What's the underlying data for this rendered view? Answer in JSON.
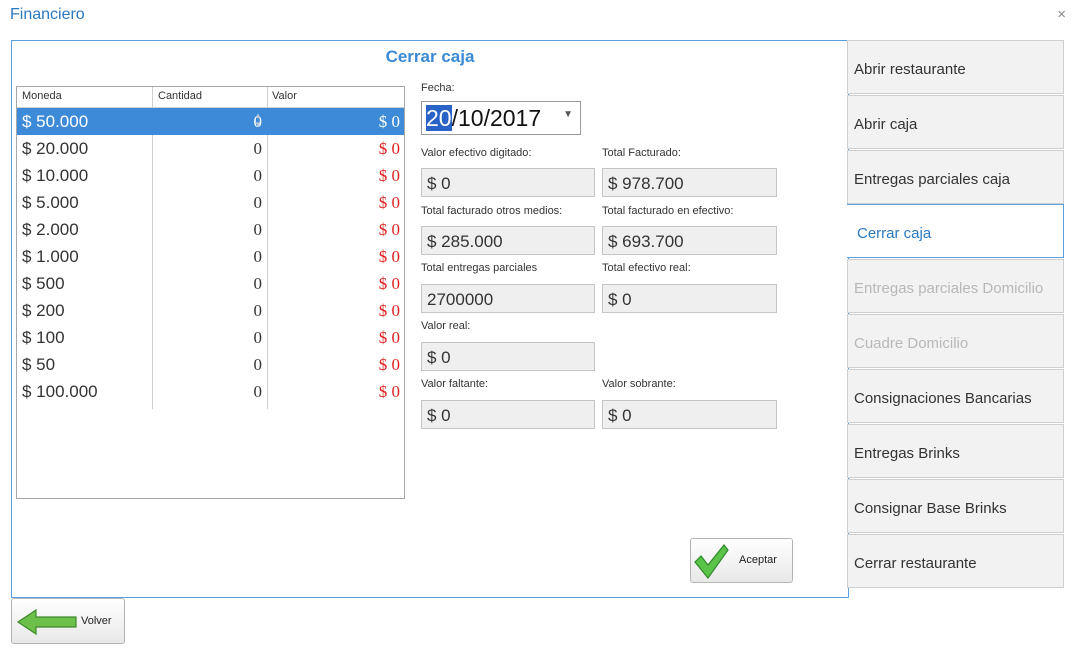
{
  "window": {
    "title": "Financiero",
    "close": "×"
  },
  "panel": {
    "title": "Cerrar caja"
  },
  "grid": {
    "headers": {
      "moneda": "Moneda",
      "cantidad": "Cantidad",
      "valor": "Valor"
    },
    "rows": [
      {
        "moneda": "$ 50.000",
        "cantidad": "0",
        "valor": "$ 0"
      },
      {
        "moneda": "$ 20.000",
        "cantidad": "0",
        "valor": "$ 0"
      },
      {
        "moneda": "$ 10.000",
        "cantidad": "0",
        "valor": "$ 0"
      },
      {
        "moneda": "$ 5.000",
        "cantidad": "0",
        "valor": "$ 0"
      },
      {
        "moneda": "$ 2.000",
        "cantidad": "0",
        "valor": "$ 0"
      },
      {
        "moneda": "$ 1.000",
        "cantidad": "0",
        "valor": "$ 0"
      },
      {
        "moneda": "$ 500",
        "cantidad": "0",
        "valor": "$ 0"
      },
      {
        "moneda": "$ 200",
        "cantidad": "0",
        "valor": "$ 0"
      },
      {
        "moneda": "$ 100",
        "cantidad": "0",
        "valor": "$ 0"
      },
      {
        "moneda": "$ 50",
        "cantidad": "0",
        "valor": "$ 0"
      },
      {
        "moneda": "$ 100.000",
        "cantidad": "0",
        "valor": "$ 0"
      }
    ]
  },
  "form": {
    "fecha_label": "Fecha:",
    "fecha_day": "20",
    "fecha_rest": "/10/2017",
    "efectivo_digitado_label": "Valor efectivo digitado:",
    "efectivo_digitado": "$ 0",
    "total_facturado_label": "Total Facturado:",
    "total_facturado": "$ 978.700",
    "otros_medios_label": "Total facturado otros medios:",
    "otros_medios": "$ 285.000",
    "facturado_efectivo_label": "Total facturado en efectivo:",
    "facturado_efectivo": "$ 693.700",
    "entregas_parciales_label": "Total entregas parciales",
    "entregas_parciales": "2700000",
    "efectivo_real_label": "Total efectivo real:",
    "efectivo_real": "$ 0",
    "valor_real_label": "Valor real:",
    "valor_real": "$ 0",
    "faltante_label": "Valor faltante:",
    "faltante": "$ 0",
    "sobrante_label": "Valor sobrante:",
    "sobrante": "$ 0"
  },
  "buttons": {
    "aceptar": "Aceptar",
    "volver": "Volver"
  },
  "menu": [
    {
      "label": "Abrir restaurante",
      "state": "normal"
    },
    {
      "label": "Abrir caja",
      "state": "normal"
    },
    {
      "label": "Entregas parciales caja",
      "state": "normal"
    },
    {
      "label": "Cerrar caja",
      "state": "active"
    },
    {
      "label": "Entregas parciales Domicilio",
      "state": "disabled"
    },
    {
      "label": "Cuadre Domicilio",
      "state": "disabled"
    },
    {
      "label": "Consignaciones Bancarias",
      "state": "normal"
    },
    {
      "label": "Entregas Brinks",
      "state": "normal"
    },
    {
      "label": "Consignar Base Brinks",
      "state": "normal"
    },
    {
      "label": "Cerrar restaurante",
      "state": "normal"
    }
  ],
  "colors": {
    "accent": "#3d8ad8",
    "negative": "#e02020",
    "disabled": "#b8b8b8"
  }
}
